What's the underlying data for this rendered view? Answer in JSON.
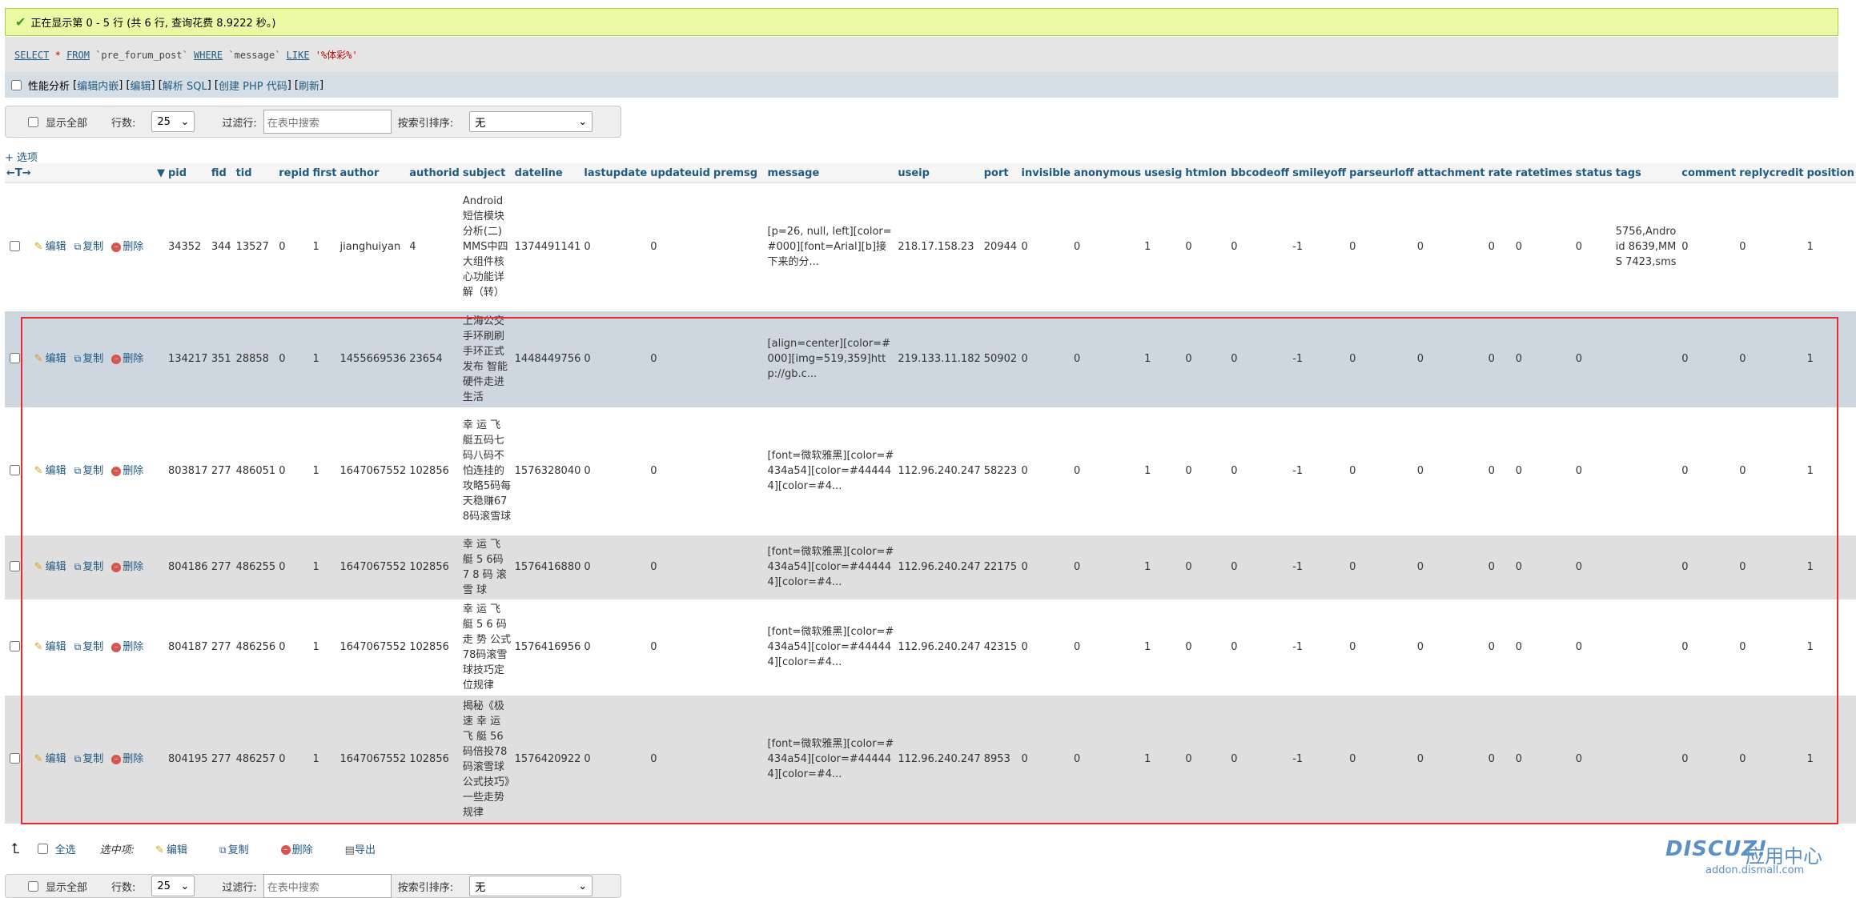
{
  "success": {
    "message": "正在显示第 0 - 5 行 (共 6 行, 查询花费 8.9222 秒。)"
  },
  "sql": {
    "select": "SELECT",
    "star": "*",
    "from": "FROM",
    "table": "`pre_forum_post`",
    "where": "WHERE",
    "field": "`message`",
    "like": "LIKE",
    "pattern": "'%体彩%'"
  },
  "profiling": {
    "label": "性能分析",
    "links": [
      "编辑内嵌",
      "编辑",
      "解析 SQL",
      "创建 PHP 代码",
      "刷新"
    ]
  },
  "nav": {
    "show_all": "显示全部",
    "rows_label": "行数:",
    "rows_value": "25",
    "filter_label": "过滤行:",
    "filter_placeholder": "在表中搜索",
    "sort_label": "按索引排序:",
    "sort_value": "无"
  },
  "options_link": "+ 选项",
  "sort_arrows": "←T→",
  "columns": [
    "pid",
    "fid",
    "tid",
    "repid",
    "first",
    "author",
    "authorid",
    "subject",
    "dateline",
    "lastupdate",
    "updateuid",
    "premsg",
    "message",
    "useip",
    "port",
    "invisible",
    "anonymous",
    "usesig",
    "htmlon",
    "bbcodeoff",
    "smileyoff",
    "parseurloff",
    "attachment",
    "rate",
    "ratetimes",
    "status",
    "tags",
    "comment",
    "replycredit",
    "position"
  ],
  "actions": {
    "edit": "编辑",
    "copy": "复制",
    "delete": "删除"
  },
  "rows": [
    {
      "pid": "34352",
      "fid": "344",
      "tid": "13527",
      "repid": "0",
      "first": "1",
      "author": "jianghuiyan",
      "authorid": "4",
      "subject": "Android短信模块分析(二) MMS中四大组件核心功能详解（转）",
      "dateline": "1374491141",
      "lastupdate": "0",
      "updateuid": "0",
      "premsg": "",
      "message": "[p=26, null, left][color=#000][font=Arial][b]接下来的分...",
      "useip": "218.17.158.23",
      "port": "20944",
      "invisible": "0",
      "anonymous": "0",
      "usesig": "1",
      "htmlon": "0",
      "bbcodeoff": "0",
      "smileyoff": "-1",
      "parseurloff": "0",
      "attachment": "0",
      "rate": "0",
      "ratetimes": "0",
      "status": "0",
      "tags": "5756,Android 8639,MMS 7423,sms",
      "comment": "0",
      "replycredit": "0",
      "position": "1"
    },
    {
      "pid": "134217",
      "fid": "351",
      "tid": "28858",
      "repid": "0",
      "first": "1",
      "author": "1455669536",
      "authorid": "23654",
      "subject": "上海公交手环刷刷手环正式发布 智能硬件走进生活",
      "dateline": "1448449756",
      "lastupdate": "0",
      "updateuid": "0",
      "premsg": "",
      "message": "[align=center][color=#000][img=519,359]http://gb.c...",
      "useip": "219.133.11.182",
      "port": "50902",
      "invisible": "0",
      "anonymous": "0",
      "usesig": "1",
      "htmlon": "0",
      "bbcodeoff": "0",
      "smileyoff": "-1",
      "parseurloff": "0",
      "attachment": "0",
      "rate": "0",
      "ratetimes": "0",
      "status": "0",
      "tags": "",
      "comment": "0",
      "replycredit": "0",
      "position": "1"
    },
    {
      "pid": "803817",
      "fid": "277",
      "tid": "486051",
      "repid": "0",
      "first": "1",
      "author": "1647067552",
      "authorid": "102856",
      "subject": "幸 运 飞 艇五码七码八码不怕连挂的攻略5码每天稳赚678码滚雪球",
      "dateline": "1576328040",
      "lastupdate": "0",
      "updateuid": "0",
      "premsg": "",
      "message": "[font=微软雅黑][color=#434a54][color=#444444][color=#4...",
      "useip": "112.96.240.247",
      "port": "58223",
      "invisible": "0",
      "anonymous": "0",
      "usesig": "1",
      "htmlon": "0",
      "bbcodeoff": "0",
      "smileyoff": "-1",
      "parseurloff": "0",
      "attachment": "0",
      "rate": "0",
      "ratetimes": "0",
      "status": "0",
      "tags": "",
      "comment": "0",
      "replycredit": "0",
      "position": "1"
    },
    {
      "pid": "804186",
      "fid": "277",
      "tid": "486255",
      "repid": "0",
      "first": "1",
      "author": "1647067552",
      "authorid": "102856",
      "subject": "幸 运 飞 艇 5 6码 7 8 码 滚雪 球",
      "dateline": "1576416880",
      "lastupdate": "0",
      "updateuid": "0",
      "premsg": "",
      "message": "[font=微软雅黑][color=#434a54][color=#444444][color=#4...",
      "useip": "112.96.240.247",
      "port": "22175",
      "invisible": "0",
      "anonymous": "0",
      "usesig": "1",
      "htmlon": "0",
      "bbcodeoff": "0",
      "smileyoff": "-1",
      "parseurloff": "0",
      "attachment": "0",
      "rate": "0",
      "ratetimes": "0",
      "status": "0",
      "tags": "",
      "comment": "0",
      "replycredit": "0",
      "position": "1"
    },
    {
      "pid": "804187",
      "fid": "277",
      "tid": "486256",
      "repid": "0",
      "first": "1",
      "author": "1647067552",
      "authorid": "102856",
      "subject": "幸 运 飞 艇 5 6 码 走 势 公式78码滚雪球技巧定位规律",
      "dateline": "1576416956",
      "lastupdate": "0",
      "updateuid": "0",
      "premsg": "",
      "message": "[font=微软雅黑][color=#434a54][color=#444444][color=#4...",
      "useip": "112.96.240.247",
      "port": "42315",
      "invisible": "0",
      "anonymous": "0",
      "usesig": "1",
      "htmlon": "0",
      "bbcodeoff": "0",
      "smileyoff": "-1",
      "parseurloff": "0",
      "attachment": "0",
      "rate": "0",
      "ratetimes": "0",
      "status": "0",
      "tags": "",
      "comment": "0",
      "replycredit": "0",
      "position": "1"
    },
    {
      "pid": "804195",
      "fid": "277",
      "tid": "486257",
      "repid": "0",
      "first": "1",
      "author": "1647067552",
      "authorid": "102856",
      "subject": "揭秘《极 速 幸 运 飞 艇 56码倍投78码滚雪球公式技巧》一些走势规律",
      "dateline": "1576420922",
      "lastupdate": "0",
      "updateuid": "0",
      "premsg": "",
      "message": "[font=微软雅黑][color=#434a54][color=#444444][color=#4...",
      "useip": "112.96.240.247",
      "port": "8953",
      "invisible": "0",
      "anonymous": "0",
      "usesig": "1",
      "htmlon": "0",
      "bbcodeoff": "0",
      "smileyoff": "-1",
      "parseurloff": "0",
      "attachment": "0",
      "rate": "0",
      "ratetimes": "0",
      "status": "0",
      "tags": "",
      "comment": "0",
      "replycredit": "0",
      "position": "1"
    }
  ],
  "bottom": {
    "select_all": "全选",
    "selected_label": "选中项:",
    "edit": "编辑",
    "copy": "复制",
    "delete": "删除",
    "export": "导出"
  },
  "watermark": {
    "brand": "DISCUZ!",
    "sub": "应用中心",
    "url": "addon.dismall.com"
  },
  "colors": {
    "accent_link": "#235a81",
    "success_bg": "#ebf8a4",
    "highlight_box": "#e32d2d"
  }
}
